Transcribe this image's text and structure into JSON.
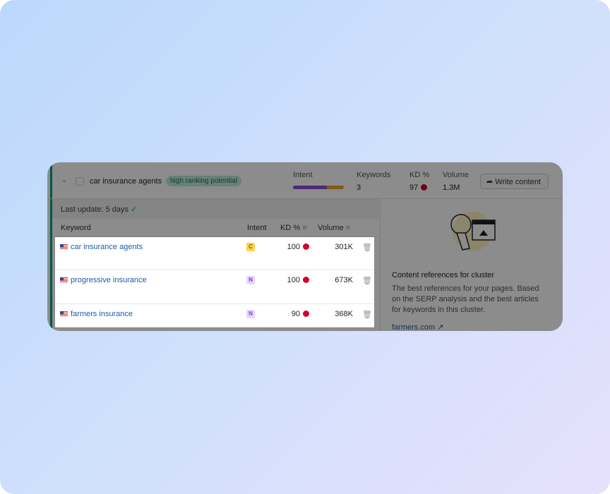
{
  "cluster": {
    "title": "car insurance agents",
    "badge": "high ranking potential",
    "intent_label": "Intent",
    "intent_colors": [
      "#8a4fd6",
      "#e3a72f"
    ],
    "intent_share": [
      0.67,
      0.33
    ],
    "keywords_label": "Keywords",
    "keywords_value": "3",
    "kd_label": "KD %",
    "kd_value": "97",
    "volume_label": "Volume",
    "volume_value": "1.3M",
    "write_button": "Write content"
  },
  "last_update": "Last update: 5 days",
  "columns": {
    "keyword": "Keyword",
    "intent": "Intent",
    "kd": "KD %",
    "volume": "Volume"
  },
  "rows": [
    {
      "keyword": "car insurance agents",
      "intent": "C",
      "kd": "100",
      "volume": "301K"
    },
    {
      "keyword": "progressive insurance",
      "intent": "N",
      "kd": "100",
      "volume": "673K"
    },
    {
      "keyword": "farmers insurance",
      "intent": "N",
      "kd": "90",
      "volume": "368K"
    }
  ],
  "references": {
    "title": "Content references for cluster",
    "description": "The best references for your pages. Based on the SERP analysis and the best articles for keywords in this cluster.",
    "link": "farmers.com"
  },
  "colors": {
    "kd_dot": "#d1002f",
    "accent": "#009f81",
    "intent_c": "#fcd34d",
    "intent_n": "#e9d5ff"
  }
}
